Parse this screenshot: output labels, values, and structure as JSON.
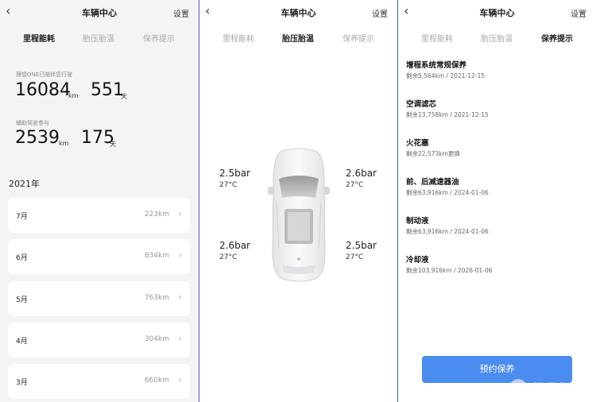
{
  "panel1": {
    "header": {
      "back_icon": "chevron-left-icon",
      "title": "车辆中心",
      "settings": "设置"
    },
    "tabs": [
      "里程能耗",
      "胎压胎温",
      "保养提示"
    ],
    "active_tab": 0,
    "stats": {
      "total_label": "理想ONE已陪伴您行驶",
      "total_km": "16084",
      "total_km_unit": "km",
      "total_days": "551",
      "total_days_unit": "天",
      "assist_label": "辅助驾驶参与",
      "assist_km": "2539",
      "assist_km_unit": "km",
      "assist_days": "175",
      "assist_days_unit": "天"
    },
    "year": "2021年",
    "months": [
      {
        "label": "7月",
        "value": "223km"
      },
      {
        "label": "6月",
        "value": "834km"
      },
      {
        "label": "5月",
        "value": "763km"
      },
      {
        "label": "4月",
        "value": "304km"
      },
      {
        "label": "3月",
        "value": "660km"
      }
    ]
  },
  "panel2": {
    "header": {
      "back_icon": "chevron-left-icon",
      "title": "车辆中心",
      "settings": "设置"
    },
    "tabs": [
      "里程能耗",
      "胎压胎温",
      "保养提示"
    ],
    "active_tab": 1,
    "tires": {
      "front_left": {
        "pressure": "2.5bar",
        "temp": "27°C"
      },
      "front_right": {
        "pressure": "2.6bar",
        "temp": "27°C"
      },
      "rear_left": {
        "pressure": "2.6bar",
        "temp": "27°C"
      },
      "rear_right": {
        "pressure": "2.5bar",
        "temp": "27°C"
      }
    },
    "car_icon": "car-top-view-icon"
  },
  "panel3": {
    "header": {
      "back_icon": "chevron-left-icon",
      "title": "车辆中心",
      "settings": "设置"
    },
    "tabs": [
      "里程能耗",
      "胎压胎温",
      "保养提示"
    ],
    "active_tab": 2,
    "items": [
      {
        "title": "增程系统常规保养",
        "detail": "剩余5,564km / 2021-12-15"
      },
      {
        "title": "空调滤芯",
        "detail": "剩余13,758km / 2021-12-15"
      },
      {
        "title": "火花塞",
        "detail": "剩余22,573km更换"
      },
      {
        "title": "前、后减速器油",
        "detail": "剩余63,916km / 2024-01-06"
      },
      {
        "title": "制动液",
        "detail": "剩余63,916km / 2024-01-06"
      },
      {
        "title": "冷却液",
        "detail": "剩余103,916km / 2026-01-06"
      }
    ],
    "book_button": "预约保养",
    "watermark": "快易车"
  },
  "colors": {
    "accent": "#4a8cf0",
    "divider": "#2f5fd6",
    "page_bg": "#f4f4f5"
  }
}
